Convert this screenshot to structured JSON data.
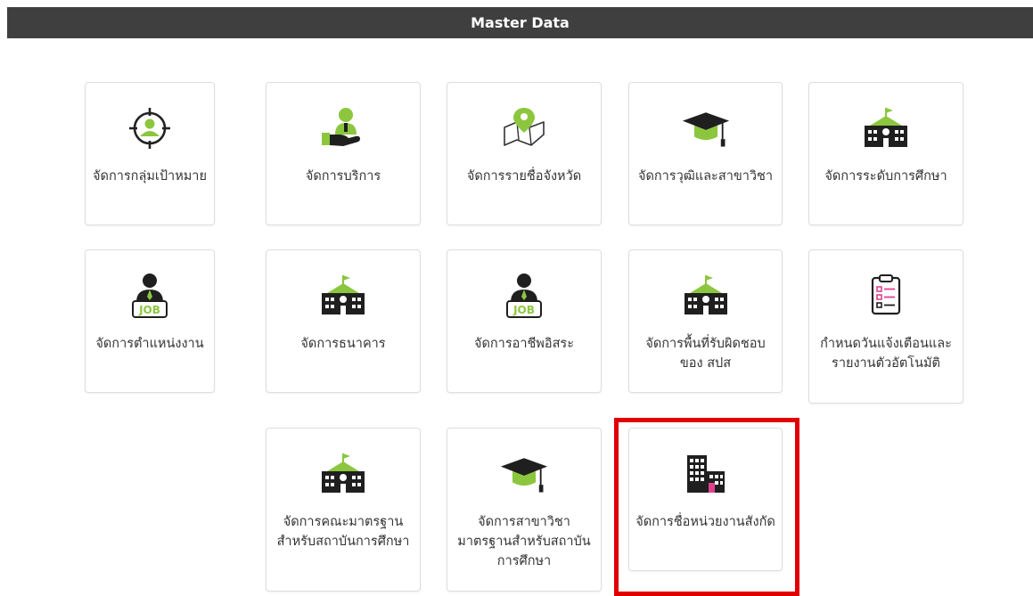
{
  "header": {
    "title": "Master Data"
  },
  "cards": [
    {
      "label": "จัดการกลุ่มเป้าหมาย",
      "icon": "target-person-icon"
    },
    {
      "label": "จัดการบริการ",
      "icon": "service-hand-icon"
    },
    {
      "label": "จัดการรายชื่อจังหวัด",
      "icon": "map-pin-icon"
    },
    {
      "label": "จัดการวุฒิและสาขาวิชา",
      "icon": "graduation-cap-icon"
    },
    {
      "label": "จัดการระดับการศึกษา",
      "icon": "school-building-icon"
    },
    {
      "label": "จัดการตำแหน่งงาน",
      "icon": "job-person-icon"
    },
    {
      "label": "จัดการธนาคาร",
      "icon": "bank-building-icon"
    },
    {
      "label": "จัดการอาชีพอิสระ",
      "icon": "job-person-icon"
    },
    {
      "label": "จัดการพื้นที่รับผิดชอบของ สปส",
      "icon": "office-building-icon"
    },
    {
      "label": "กำหนดวันแจ้งเตือนและรายงานตัวอัตโนมัติ",
      "icon": "clipboard-checklist-icon"
    },
    {
      "label": "จัดการคณะมาตรฐานสำหรับสถาบันการศึกษา",
      "icon": "school-building-icon"
    },
    {
      "label": "จัดการสาขาวิชามาตรฐานสำหรับสถาบันการศึกษา",
      "icon": "graduation-cap-icon"
    },
    {
      "label": "จัดการชื่อหน่วยงานสังกัด",
      "icon": "city-buildings-icon"
    }
  ],
  "colors": {
    "accent": "#8cc63f",
    "header": "#3f3f3f",
    "highlight": "#e00000",
    "pink": "#e0418f"
  }
}
